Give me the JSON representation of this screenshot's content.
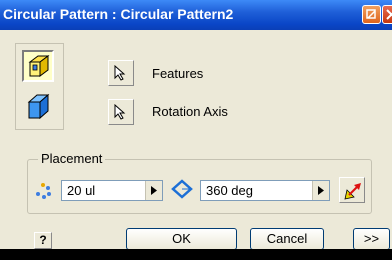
{
  "window": {
    "title": "Circular Pattern : Circular Pattern2"
  },
  "left_panel": {
    "modes": [
      {
        "icon": "join-features-icon"
      },
      {
        "icon": "pattern-solid-icon"
      }
    ]
  },
  "selectors": {
    "features_label": "Features",
    "rotation_axis_label": "Rotation Axis"
  },
  "placement": {
    "legend": "Placement",
    "count_value": "20 ul",
    "angle_value": "360 deg"
  },
  "buttons": {
    "help": "?",
    "ok": "OK",
    "cancel": "Cancel",
    "more": ">>"
  },
  "colors": {
    "title_bar": "#0a46c7",
    "dialog_bg": "#ece9d8"
  }
}
